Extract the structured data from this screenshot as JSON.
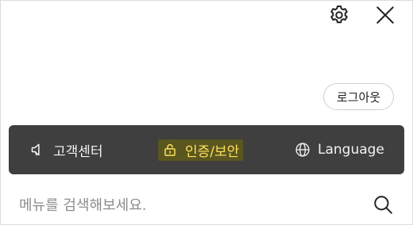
{
  "header": {
    "settings_icon": "gear-icon",
    "close_icon": "close-icon"
  },
  "account": {
    "logout_label": "로그아웃"
  },
  "bottom_bar": {
    "background": "#3f3f3f",
    "items": [
      {
        "label": "고객센터",
        "icon": "speaker-icon"
      },
      {
        "label": "인증/보안",
        "icon": "lock-icon",
        "highlight_color": "#ffe15a"
      },
      {
        "label": "Language",
        "icon": "globe-icon"
      }
    ]
  },
  "search": {
    "placeholder": "메뉴를 검색해보세요.",
    "value": "",
    "icon": "search-icon"
  }
}
